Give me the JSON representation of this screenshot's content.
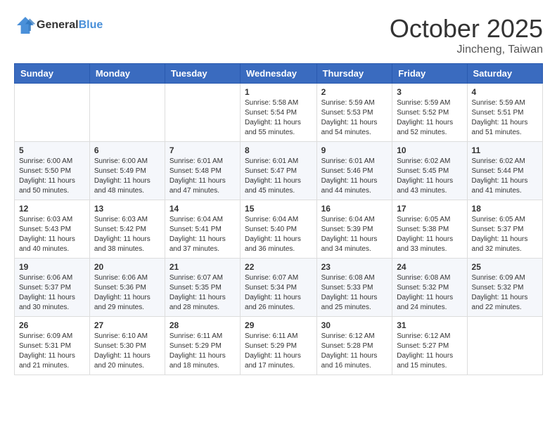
{
  "logo": {
    "general": "General",
    "blue": "Blue"
  },
  "title": "October 2025",
  "location": "Jincheng, Taiwan",
  "days_of_week": [
    "Sunday",
    "Monday",
    "Tuesday",
    "Wednesday",
    "Thursday",
    "Friday",
    "Saturday"
  ],
  "weeks": [
    [
      {
        "day": "",
        "sunrise": "",
        "sunset": "",
        "daylight": ""
      },
      {
        "day": "",
        "sunrise": "",
        "sunset": "",
        "daylight": ""
      },
      {
        "day": "",
        "sunrise": "",
        "sunset": "",
        "daylight": ""
      },
      {
        "day": "1",
        "sunrise": "Sunrise: 5:58 AM",
        "sunset": "Sunset: 5:54 PM",
        "daylight": "Daylight: 11 hours and 55 minutes."
      },
      {
        "day": "2",
        "sunrise": "Sunrise: 5:59 AM",
        "sunset": "Sunset: 5:53 PM",
        "daylight": "Daylight: 11 hours and 54 minutes."
      },
      {
        "day": "3",
        "sunrise": "Sunrise: 5:59 AM",
        "sunset": "Sunset: 5:52 PM",
        "daylight": "Daylight: 11 hours and 52 minutes."
      },
      {
        "day": "4",
        "sunrise": "Sunrise: 5:59 AM",
        "sunset": "Sunset: 5:51 PM",
        "daylight": "Daylight: 11 hours and 51 minutes."
      }
    ],
    [
      {
        "day": "5",
        "sunrise": "Sunrise: 6:00 AM",
        "sunset": "Sunset: 5:50 PM",
        "daylight": "Daylight: 11 hours and 50 minutes."
      },
      {
        "day": "6",
        "sunrise": "Sunrise: 6:00 AM",
        "sunset": "Sunset: 5:49 PM",
        "daylight": "Daylight: 11 hours and 48 minutes."
      },
      {
        "day": "7",
        "sunrise": "Sunrise: 6:01 AM",
        "sunset": "Sunset: 5:48 PM",
        "daylight": "Daylight: 11 hours and 47 minutes."
      },
      {
        "day": "8",
        "sunrise": "Sunrise: 6:01 AM",
        "sunset": "Sunset: 5:47 PM",
        "daylight": "Daylight: 11 hours and 45 minutes."
      },
      {
        "day": "9",
        "sunrise": "Sunrise: 6:01 AM",
        "sunset": "Sunset: 5:46 PM",
        "daylight": "Daylight: 11 hours and 44 minutes."
      },
      {
        "day": "10",
        "sunrise": "Sunrise: 6:02 AM",
        "sunset": "Sunset: 5:45 PM",
        "daylight": "Daylight: 11 hours and 43 minutes."
      },
      {
        "day": "11",
        "sunrise": "Sunrise: 6:02 AM",
        "sunset": "Sunset: 5:44 PM",
        "daylight": "Daylight: 11 hours and 41 minutes."
      }
    ],
    [
      {
        "day": "12",
        "sunrise": "Sunrise: 6:03 AM",
        "sunset": "Sunset: 5:43 PM",
        "daylight": "Daylight: 11 hours and 40 minutes."
      },
      {
        "day": "13",
        "sunrise": "Sunrise: 6:03 AM",
        "sunset": "Sunset: 5:42 PM",
        "daylight": "Daylight: 11 hours and 38 minutes."
      },
      {
        "day": "14",
        "sunrise": "Sunrise: 6:04 AM",
        "sunset": "Sunset: 5:41 PM",
        "daylight": "Daylight: 11 hours and 37 minutes."
      },
      {
        "day": "15",
        "sunrise": "Sunrise: 6:04 AM",
        "sunset": "Sunset: 5:40 PM",
        "daylight": "Daylight: 11 hours and 36 minutes."
      },
      {
        "day": "16",
        "sunrise": "Sunrise: 6:04 AM",
        "sunset": "Sunset: 5:39 PM",
        "daylight": "Daylight: 11 hours and 34 minutes."
      },
      {
        "day": "17",
        "sunrise": "Sunrise: 6:05 AM",
        "sunset": "Sunset: 5:38 PM",
        "daylight": "Daylight: 11 hours and 33 minutes."
      },
      {
        "day": "18",
        "sunrise": "Sunrise: 6:05 AM",
        "sunset": "Sunset: 5:37 PM",
        "daylight": "Daylight: 11 hours and 32 minutes."
      }
    ],
    [
      {
        "day": "19",
        "sunrise": "Sunrise: 6:06 AM",
        "sunset": "Sunset: 5:37 PM",
        "daylight": "Daylight: 11 hours and 30 minutes."
      },
      {
        "day": "20",
        "sunrise": "Sunrise: 6:06 AM",
        "sunset": "Sunset: 5:36 PM",
        "daylight": "Daylight: 11 hours and 29 minutes."
      },
      {
        "day": "21",
        "sunrise": "Sunrise: 6:07 AM",
        "sunset": "Sunset: 5:35 PM",
        "daylight": "Daylight: 11 hours and 28 minutes."
      },
      {
        "day": "22",
        "sunrise": "Sunrise: 6:07 AM",
        "sunset": "Sunset: 5:34 PM",
        "daylight": "Daylight: 11 hours and 26 minutes."
      },
      {
        "day": "23",
        "sunrise": "Sunrise: 6:08 AM",
        "sunset": "Sunset: 5:33 PM",
        "daylight": "Daylight: 11 hours and 25 minutes."
      },
      {
        "day": "24",
        "sunrise": "Sunrise: 6:08 AM",
        "sunset": "Sunset: 5:32 PM",
        "daylight": "Daylight: 11 hours and 24 minutes."
      },
      {
        "day": "25",
        "sunrise": "Sunrise: 6:09 AM",
        "sunset": "Sunset: 5:32 PM",
        "daylight": "Daylight: 11 hours and 22 minutes."
      }
    ],
    [
      {
        "day": "26",
        "sunrise": "Sunrise: 6:09 AM",
        "sunset": "Sunset: 5:31 PM",
        "daylight": "Daylight: 11 hours and 21 minutes."
      },
      {
        "day": "27",
        "sunrise": "Sunrise: 6:10 AM",
        "sunset": "Sunset: 5:30 PM",
        "daylight": "Daylight: 11 hours and 20 minutes."
      },
      {
        "day": "28",
        "sunrise": "Sunrise: 6:11 AM",
        "sunset": "Sunset: 5:29 PM",
        "daylight": "Daylight: 11 hours and 18 minutes."
      },
      {
        "day": "29",
        "sunrise": "Sunrise: 6:11 AM",
        "sunset": "Sunset: 5:29 PM",
        "daylight": "Daylight: 11 hours and 17 minutes."
      },
      {
        "day": "30",
        "sunrise": "Sunrise: 6:12 AM",
        "sunset": "Sunset: 5:28 PM",
        "daylight": "Daylight: 11 hours and 16 minutes."
      },
      {
        "day": "31",
        "sunrise": "Sunrise: 6:12 AM",
        "sunset": "Sunset: 5:27 PM",
        "daylight": "Daylight: 11 hours and 15 minutes."
      },
      {
        "day": "",
        "sunrise": "",
        "sunset": "",
        "daylight": ""
      }
    ]
  ]
}
